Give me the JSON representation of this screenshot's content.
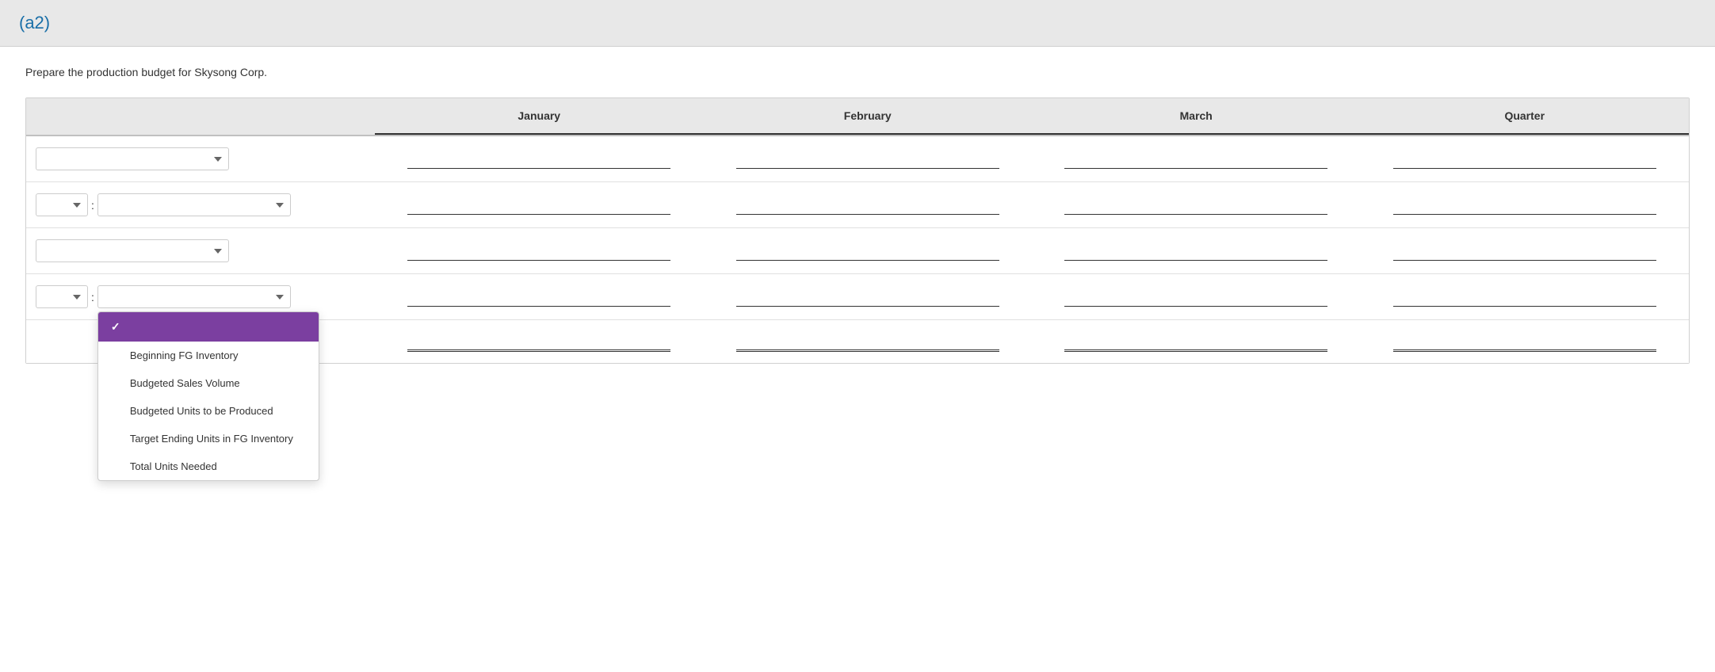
{
  "header": {
    "title": "(a2)"
  },
  "instruction": "Prepare the production budget for Skysong Corp.",
  "table": {
    "columns": [
      "",
      "January",
      "February",
      "March",
      "Quarter"
    ],
    "rows": [
      {
        "type": "single-dropdown",
        "dropdown_value": "",
        "values": [
          "",
          "",
          "",
          ""
        ]
      },
      {
        "type": "double-dropdown",
        "dropdown1_value": "",
        "dropdown2_value": "",
        "values": [
          "",
          "",
          "",
          ""
        ]
      },
      {
        "type": "single-dropdown",
        "dropdown_value": "",
        "values": [
          "",
          "",
          "",
          ""
        ]
      },
      {
        "type": "double-dropdown",
        "dropdown1_value": "",
        "dropdown2_value": "",
        "values": [
          "",
          "",
          "",
          ""
        ]
      },
      {
        "type": "total",
        "values": [
          "",
          "",
          "",
          ""
        ]
      }
    ],
    "dropdown_options": [
      "Beginning FG Inventory",
      "Budgeted Sales Volume",
      "Budgeted Units to be Produced",
      "Target Ending Units in FG Inventory",
      "Total Units Needed"
    ]
  },
  "dropdown_popup": {
    "items": [
      {
        "label": "",
        "selected": true
      },
      {
        "label": "Beginning FG Inventory",
        "selected": false
      },
      {
        "label": "Budgeted Sales Volume",
        "selected": false
      },
      {
        "label": "Budgeted Units to be Produced",
        "selected": false
      },
      {
        "label": "Target Ending Units in FG Inventory",
        "selected": false
      },
      {
        "label": "Total Units Needed",
        "selected": false
      }
    ]
  },
  "labels": {
    "colon": ":"
  }
}
